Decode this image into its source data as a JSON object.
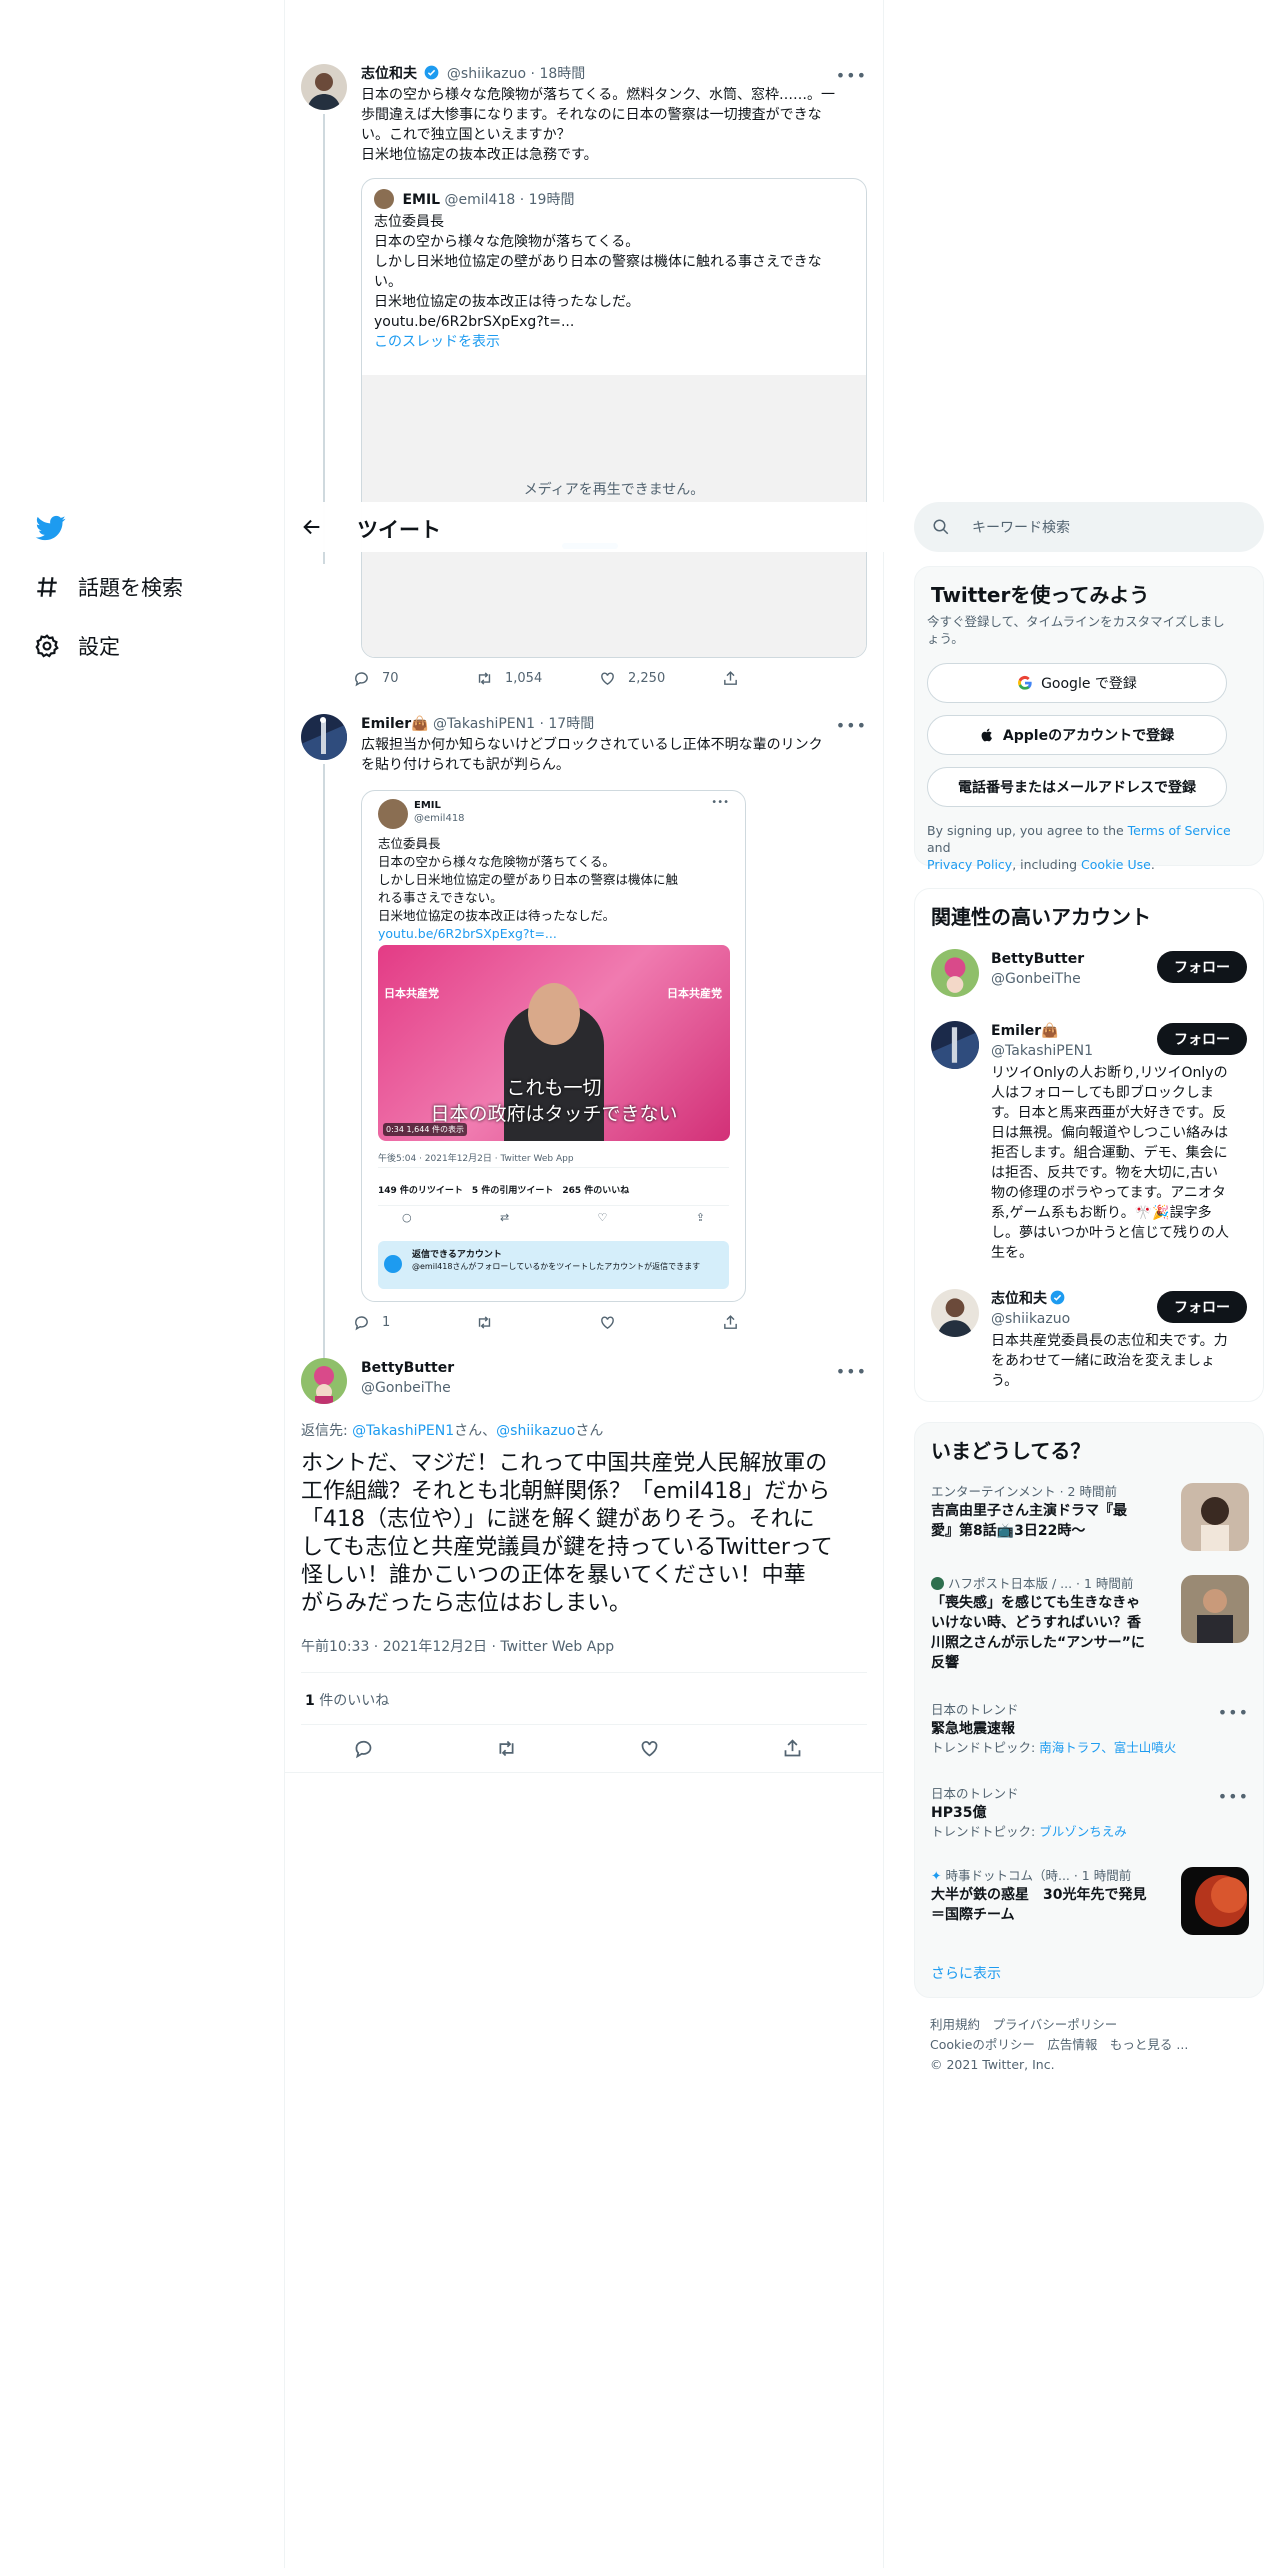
{
  "nav": {
    "explore_label": "話題を検索",
    "settings_label": "設定"
  },
  "header": {
    "title": "ツイート"
  },
  "tweet1": {
    "name": "志位和夫",
    "handle": "@shiikazuo",
    "time": "· 18時間",
    "lines": [
      "日本の空から様々な危険物が落ちてくる。燃料タンク、水筒、窓枠……。一",
      "歩間違えば大惨事になります。それなのに日本の警察は一切捜査ができな",
      "い。これで独立国といえますか？",
      "日米地位協定の抜本改正は急務です。"
    ],
    "quote": {
      "name": "EMIL",
      "handle": "@emil418",
      "time": "· 19時間",
      "lines": [
        "志位委員長",
        "日本の空から様々な危険物が落ちてくる。",
        "しかし日米地位協定の壁があり日本の警察は機体に触れる事さえできな",
        "い。",
        "日米地位協定の抜本改正は待ったなしだ。",
        "youtu.be/6R2brSXpExg?t=..."
      ],
      "thread_link": "このスレッドを表示",
      "media_error": "メディアを再生できません。"
    },
    "replies": "70",
    "retweets": "1,054",
    "likes": "2,250"
  },
  "tweet2": {
    "name": "Emiler👜",
    "handle": "@TakashiPEN1",
    "time": "· 17時間",
    "lines": [
      "広報担当か何か知らないけどブロックされているし正体不明な輩のリンク",
      "を貼り付けられても訳が判らん。"
    ],
    "screenshot": {
      "name": "EMIL",
      "handle": "@emil418",
      "lines": [
        "志位委員長",
        "日本の空から様々な危険物が落ちてくる。",
        "しかし日米地位協定の壁があり日本の警察は機体に触",
        "れる事さえできない。",
        "日米地位協定の抜本改正は待ったなしだ。"
      ],
      "link": "youtu.be/6R2brSXpExg?t=...",
      "caption1": "これも一切",
      "caption2": "日本の政府はタッチできない",
      "video_time": "0:34 1,644 件の表示",
      "poster_text": "日本共産党",
      "timestamp": "午後5:04 · 2021年12月2日 · Twitter Web App",
      "stats": "149 件のリツイート　5 件の引用ツイート　265 件のいいね",
      "notice_title": "返信できるアカウント",
      "notice_body": "@emil418さんがフォローしているかをツイートしたアカウントが返信できます"
    },
    "replies": "1"
  },
  "tweet3": {
    "name": "BettyButter",
    "handle": "@GonbeiThe",
    "reply_prefix": "返信先: ",
    "reply_to1": "@TakashiPEN1",
    "reply_mid": "さん、",
    "reply_to2": "@shiikazuo",
    "reply_suffix": "さん",
    "lines": [
      "ホントだ、マジだ！これって中国共産党人民解放軍の",
      "工作組織？それとも北朝鮮関係？「emil418」だから",
      "「418（志位や）」に謎を解く鍵がありそう。それに",
      "しても志位と共産党議員が鍵を持っているTwitterって",
      "怪しい！誰かこいつの正体を暴いてください！中華",
      "がらみだったら志位はおしまい。"
    ],
    "timestamp": "午前10:33 · 2021年12月2日 · Twitter Web App",
    "likes_count": "1",
    "likes_label": " 件のいいね"
  },
  "search": {
    "placeholder": "キーワード検索"
  },
  "signup": {
    "title": "Twitterを使ってみよう",
    "subtitle1": "今すぐ登録して、タイムラインをカスタマイズしまし",
    "subtitle2": "ょう。",
    "google": "Google で登録",
    "apple": "Appleのアカウントで登録",
    "phone": "電話番号またはメールアドレスで登録",
    "terms_pre": "By signing up, you agree to the ",
    "terms_link": "Terms of Service",
    "terms_and": " and",
    "privacy_link": "Privacy Policy",
    "terms_including": ", including ",
    "cookie_link": "Cookie Use",
    "terms_end": "."
  },
  "relevant": {
    "title": "関連性の高いアカウント",
    "follow": "フォロー",
    "accounts": [
      {
        "name": "BettyButter",
        "handle": "@GonbeiThe",
        "bio": []
      },
      {
        "name": "Emiler👜",
        "handle": "@TakashiPEN1",
        "bio": [
          "リツイOnlyの人お断り,リツイOnlyの",
          "人はフォローしても即ブロックしま",
          "す。日本と馬来西亜が大好きです。反",
          "日は無視。偏向報道やしつこい絡みは",
          "拒否します。組合運動、デモ、集会に",
          "は拒否、反共です。物を大切に,古い",
          "物の修理のボラやってます。アニオタ",
          "系,ゲーム系もお断り。🎌🎉誤字多",
          "し。夢はいつか叶うと信じて残りの人",
          "生を。"
        ]
      },
      {
        "name": "志位和夫",
        "handle": "@shiikazuo",
        "bio": [
          "日本共産党委員長の志位和夫です。力",
          "をあわせて一緒に政治を変えましょ",
          "う。"
        ]
      }
    ]
  },
  "trends": {
    "title": "いまどうしてる？",
    "items": [
      {
        "meta": "エンターテインメント · 2 時間前",
        "title1": "吉高由里子さん主演ドラマ『最",
        "title2": "愛』第8話📺3日22時〜"
      },
      {
        "meta": "ハフポスト日本版 / ... · 1 時間前",
        "title1": "「喪失感」を感じても生きなきゃ",
        "title2": "いけない時、どうすればいい？香",
        "title3": "川照之さんが示した“アンサー”に",
        "title4": "反響"
      },
      {
        "meta": "日本のトレンド",
        "title1": "緊急地震速報",
        "topics_label": "トレンドトピック: ",
        "topics": "南海トラフ、富士山噴火"
      },
      {
        "meta": "日本のトレンド",
        "title1": "HP35億",
        "topics_label": "トレンドトピック: ",
        "topics": "ブルゾンちえみ"
      },
      {
        "meta": "時事ドットコム（時... · 1 時間前",
        "title1": "大半が鉄の惑星　30光年先で発見",
        "title2": "＝国際チーム"
      }
    ],
    "more": "さらに表示"
  },
  "footer": {
    "line1": "利用規約　プライバシーポリシー",
    "line2": "Cookieのポリシー　広告情報　もっと見る ...",
    "line3": "© 2021 Twitter, Inc."
  }
}
